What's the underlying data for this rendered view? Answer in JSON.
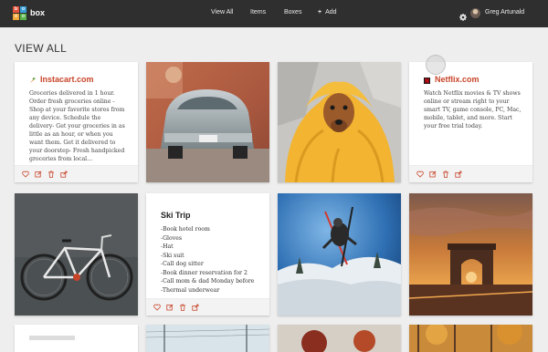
{
  "brand": {
    "logo_letters": [
      "b",
      "o",
      "x",
      "o"
    ],
    "name": "box"
  },
  "nav": {
    "view_all": "View All",
    "items": "Items",
    "boxes": "Boxes",
    "add": "Add",
    "add_icon": "+"
  },
  "user": {
    "name": "Greg Artunald",
    "settings_icon": "gear-icon"
  },
  "page": {
    "title": "VIEW ALL"
  },
  "cards": {
    "instacart": {
      "title": "Instacart.com",
      "body": "Groceries delivered in 1 hour. Order fresh groceries online - Shop at your favorite stores from any device. Schedule the delivery- Get your groceries in as little as an hour, or when you want them. Get it delivered to your doorstep- Fresh handpicked groceries from local..."
    },
    "netflix": {
      "title": "Netflix.com",
      "body": "Watch Netflix movies & TV shows online or stream right to your smart TV, game console, PC, Mac, mobile, tablet, and more. Start your free trial today."
    },
    "ski_trip": {
      "title": "Ski Trip",
      "lines": [
        "-Book hotel room",
        "-Gloves",
        "-Hat",
        "-Ski suit",
        "-Call dog sitter",
        "-Book dinner reservation for 2",
        "-Call mom & dad Monday before",
        "-Thermal underwear"
      ]
    }
  },
  "card_actions": [
    "heart-icon",
    "edit-icon",
    "trash-icon",
    "share-icon"
  ],
  "colors": {
    "topbar": "#2f2f2f",
    "background": "#eeeeee",
    "link_accent": "#c8452a",
    "logo": [
      "#e4533b",
      "#3aa0d8",
      "#f2a93b",
      "#58b44b"
    ]
  }
}
